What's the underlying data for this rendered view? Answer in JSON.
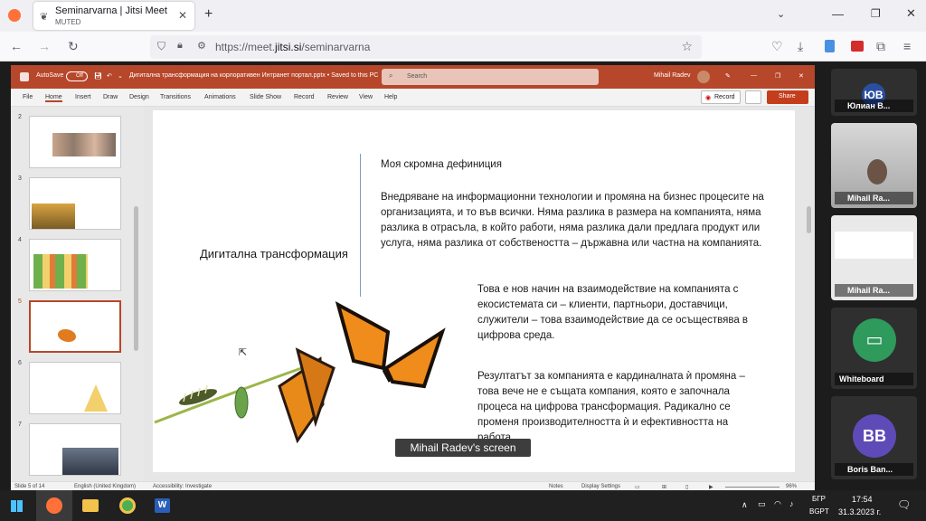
{
  "browser": {
    "tab_title": "Seminarvarna | Jitsi Meet",
    "tab_subtitle": "MUTED",
    "url_prefix": "https://meet.",
    "url_domain": "jitsi.si",
    "url_path": "/seminarvarna"
  },
  "powerpoint": {
    "autosave_label": "AutoSave",
    "autosave_state": "Off",
    "file_title": "Дигитална трансформация на корпоративен Интранет портал.pptx • Saved to this PC",
    "search_placeholder": "Search",
    "user_name": "Mihail Radev",
    "menu": [
      "File",
      "Home",
      "Insert",
      "Draw",
      "Design",
      "Transitions",
      "Animations",
      "Slide Show",
      "Record",
      "Review",
      "View",
      "Help"
    ],
    "record_button": "Record",
    "share_button": "Share",
    "thumb_numbers": [
      "2",
      "3",
      "4",
      "5",
      "6",
      "7"
    ],
    "status": {
      "slide_of": "Slide 5 of 14",
      "language": "English (United Kingdom)",
      "accessibility": "Accessibility: Investigate",
      "notes": "Notes",
      "display": "Display Settings",
      "zoom": "96%"
    }
  },
  "slide": {
    "left_title": "Дигитална трансформация",
    "heading": "Моя скромна дефиниция",
    "para1": "Внедряване на информационни технологии и промяна на бизнес процесите на организацията, и то във всички. Няма разлика в размера на компанията, няма разлика в отрасъла, в който работи, няма разлика дали предлага продукт или услуга, няма разлика от собствеността – държавна или частна на компанията.",
    "para2": "Това е нов начин на взаимодействие на компанията с екосистемата си – клиенти, партньори, доставчици, служители – това взаимодействие да се осъществява в цифрова среда.",
    "para3": "Резултатът за компанията е кардиналната ѝ промяна – това вече не е същата компания, която е започнала процеса на цифрова трансформация. Радикално се променя производителността ѝ и ефективността на работа."
  },
  "screen_label": "Mihail Radev's screen",
  "participants": [
    {
      "initials": "ЮВ",
      "name": "Юлиан В...",
      "color": "#2a4fa0"
    },
    {
      "initials": "",
      "name": "Mihail Ra...",
      "color": ""
    },
    {
      "initials": "",
      "name": "Mihail Ra...",
      "color": ""
    },
    {
      "initials": "",
      "name": "Whiteboard",
      "color": "#2e9a5c"
    },
    {
      "initials": "BB",
      "name": "Boris Ban...",
      "color": "#5e4bb8"
    }
  ],
  "taskbar": {
    "lang1": "БГР",
    "lang2": "BGPT",
    "time": "17:54",
    "date": "31.3.2023 г."
  }
}
